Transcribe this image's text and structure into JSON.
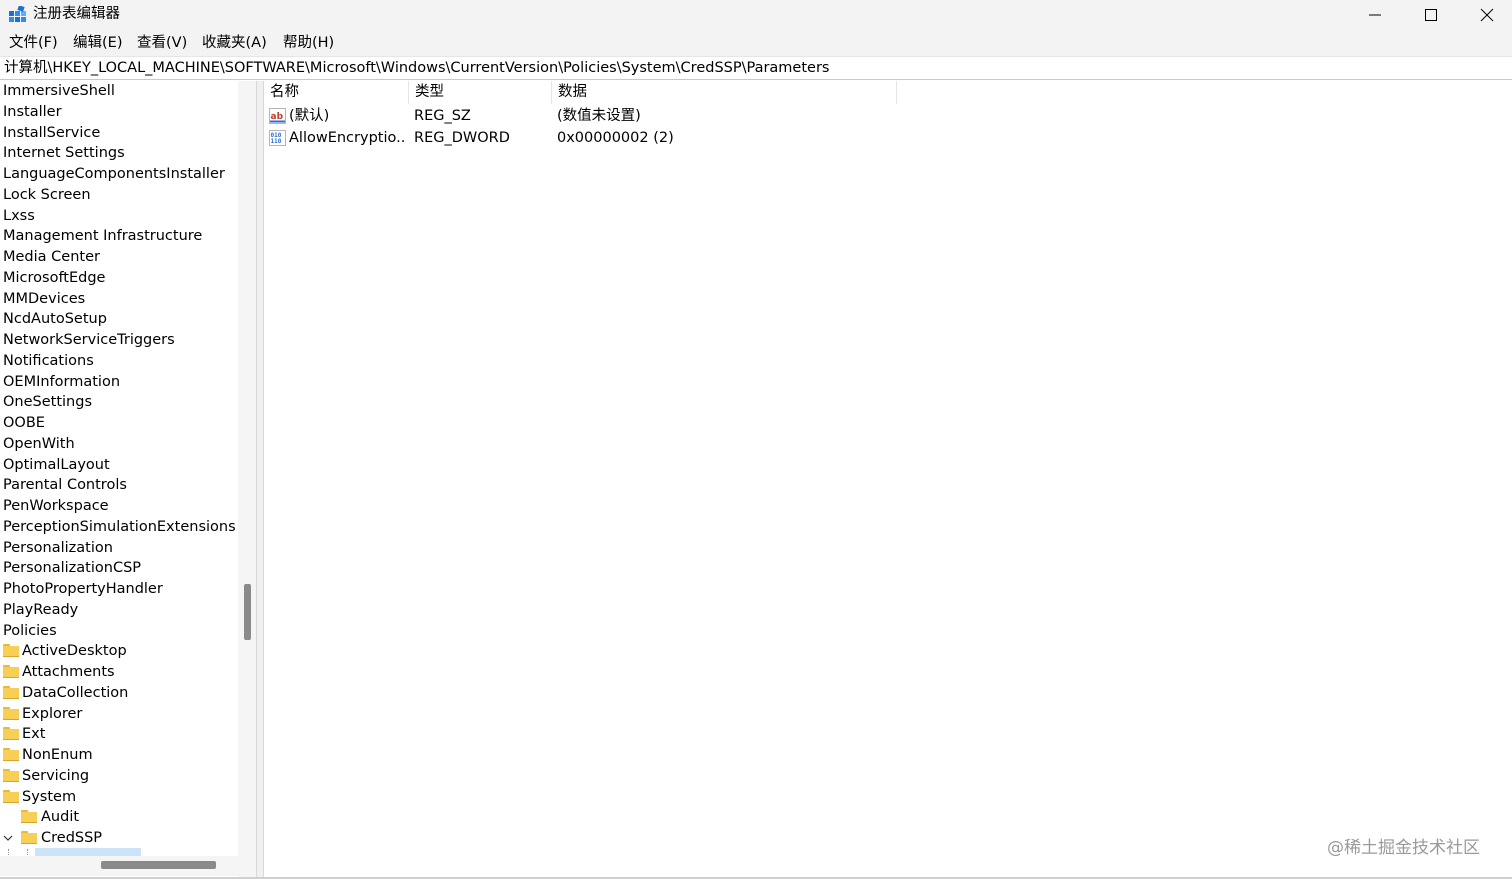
{
  "window": {
    "title": "注册表编辑器"
  },
  "menu": [
    "文件(F)",
    "编辑(E)",
    "查看(V)",
    "收藏夹(A)",
    "帮助(H)"
  ],
  "address": "计算机\\HKEY_LOCAL_MACHINE\\SOFTWARE\\Microsoft\\Windows\\CurrentVersion\\Policies\\System\\CredSSP\\Parameters",
  "tree": {
    "plain_items": [
      "ImmersiveShell",
      "Installer",
      "InstallService",
      "Internet Settings",
      "LanguageComponentsInstaller",
      "Lock Screen",
      "Lxss",
      "Management Infrastructure",
      "Media Center",
      "MicrosoftEdge",
      "MMDevices",
      "NcdAutoSetup",
      "NetworkServiceTriggers",
      "Notifications",
      "OEMInformation",
      "OneSettings",
      "OOBE",
      "OpenWith",
      "OptimalLayout",
      "Parental Controls",
      "PenWorkspace",
      "PerceptionSimulationExtensions",
      "Personalization",
      "PersonalizationCSP",
      "PhotoPropertyHandler",
      "PlayReady",
      "Policies"
    ],
    "policy_children": [
      "ActiveDesktop",
      "Attachments",
      "DataCollection",
      "Explorer",
      "Ext",
      "NonEnum",
      "Servicing",
      "System"
    ],
    "system_children": [
      "Audit",
      "CredSSP"
    ]
  },
  "list": {
    "headers": {
      "name": "名称",
      "type": "类型",
      "data": "数据"
    },
    "rows": [
      {
        "name": "(默认)",
        "type": "REG_SZ",
        "data": "(数值未设置)",
        "icon": "reg-sz-icon"
      },
      {
        "name": "AllowEncryptio...",
        "type": "REG_DWORD",
        "data": "0x00000002 (2)",
        "icon": "reg-dword-icon"
      }
    ]
  },
  "watermark": "@稀土掘金技术社区"
}
